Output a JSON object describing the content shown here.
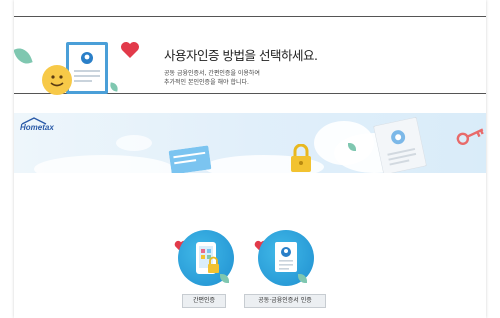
{
  "popup": {
    "title": "사용자인증 방법을 선택하세요.",
    "desc_line1": "공동 금융인증서, 간편인증을 이용하여",
    "desc_line2": "추가적인 본인인증을 해야 합니다."
  },
  "banner": {
    "logo_text": "Hometax"
  },
  "options": [
    {
      "label": "간편인증",
      "icon": "phone-lock-icon"
    },
    {
      "label": "공동·금융인증서 인증",
      "icon": "certificate-icon"
    }
  ],
  "colors": {
    "accent_blue": "#2a9fe0",
    "heart_red": "#e23a4a",
    "leaf_green": "#7fc7b0",
    "lock_yellow": "#f2c230"
  }
}
